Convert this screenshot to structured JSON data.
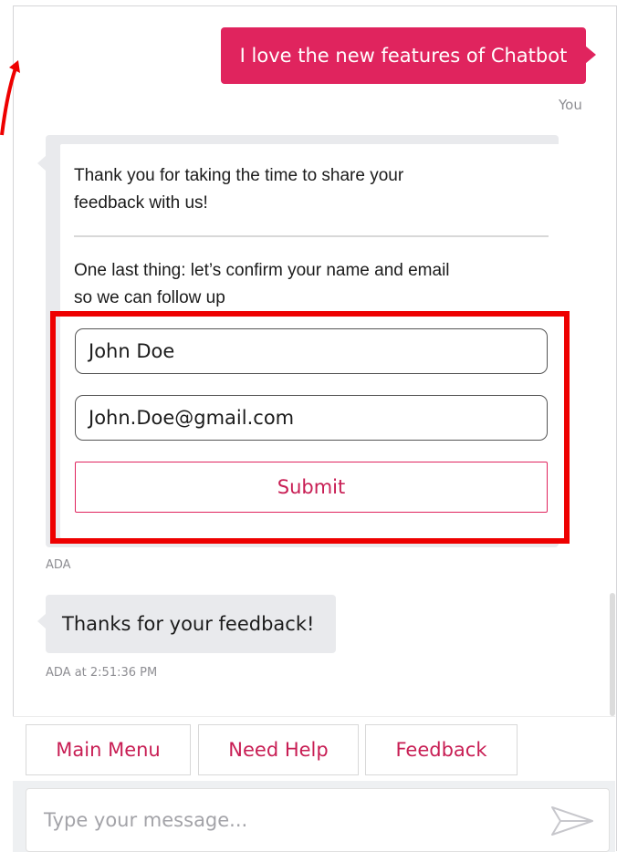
{
  "conversation": {
    "user_message": "I love the new features of Chatbot",
    "user_sender": "You",
    "bot_message_1": "Thank you for taking the time to share your\nfeedback with us!",
    "bot_message_2": "One last thing: let’s confirm your name and email\nso we can follow up",
    "form": {
      "name_value": "John Doe",
      "email_value": "John.Doe@gmail.com",
      "submit_label": "Submit"
    },
    "bot_sender": "ADA",
    "bot_reply": "Thanks for your feedback!",
    "bot_reply_meta": "ADA at 2:51:36 PM"
  },
  "quick_replies": [
    "Main Menu",
    "Need Help",
    "Feedback"
  ],
  "composer": {
    "placeholder": "Type your message...",
    "send_icon": "send-icon"
  },
  "colors": {
    "accent": "#e0245e",
    "bubble_bg": "#e9eaed",
    "highlight": "#ee0000"
  }
}
